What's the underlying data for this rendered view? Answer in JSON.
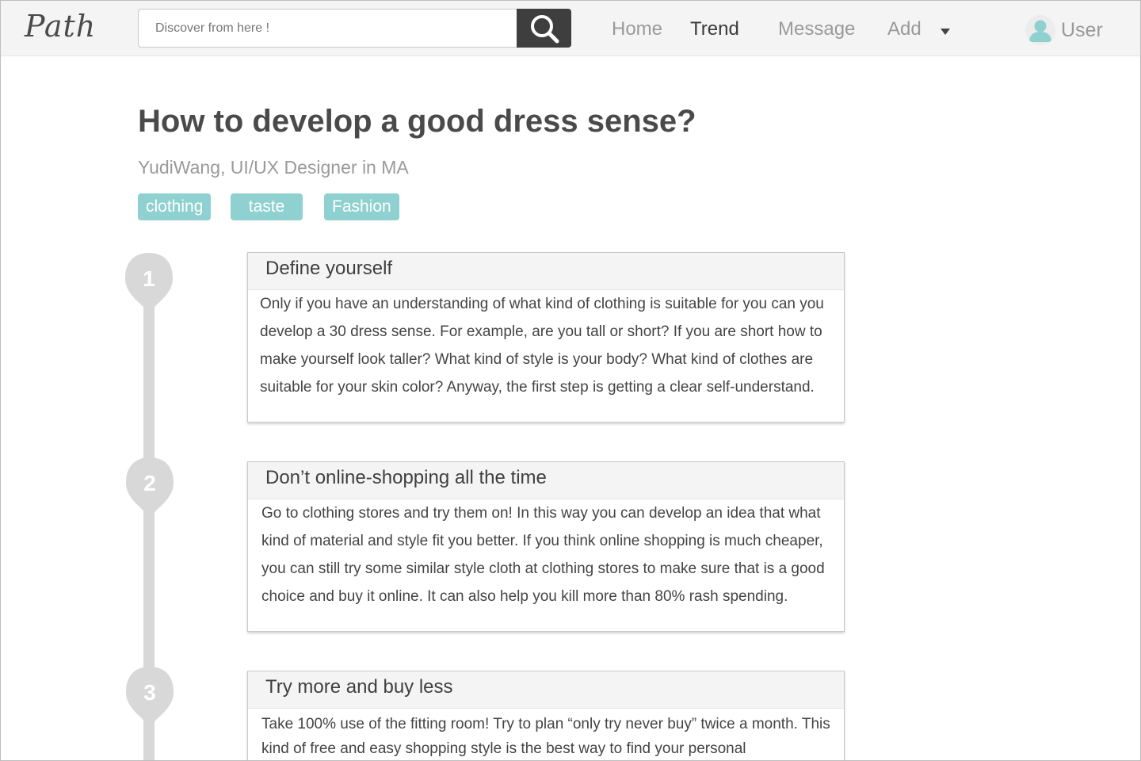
{
  "app": {
    "logo": "Path"
  },
  "search": {
    "placeholder": "Discover from here !"
  },
  "nav": {
    "home": "Home",
    "trend": "Trend",
    "message": "Message",
    "add": "Add",
    "user": "User"
  },
  "article": {
    "title": "How to develop a good dress sense?",
    "author": "YudiWang, UI/UX Designer in MA",
    "tags": [
      "clothing",
      "taste",
      "Fashion"
    ],
    "steps": [
      {
        "number": "1",
        "heading": "Define yourself",
        "body": "Only if you have an understanding of what kind of clothing is suitable for you can you develop a 30 dress sense. For example, are you tall or short? If you are short how to make yourself look taller? What kind of style is your body? What kind of clothes are suitable for your skin color? Anyway, the first step is getting a clear self-understand."
      },
      {
        "number": "2",
        "heading": "Don’t online-shopping all the time",
        "body": "Go to clothing stores and try them on! In this way you can develop an idea that what kind of material and style fit you better. If you think online shopping is much cheaper, you can still try some similar style cloth at clothing stores to make sure that is a good choice and buy it online. It can also help you kill more than 80% rash spending."
      },
      {
        "number": "3",
        "heading": "Try more and buy less",
        "body": "Take 100% use of the fitting room! Try to plan “only try never buy” twice a month. This kind of free and easy shopping style is the best way to find your personal"
      }
    ]
  },
  "colors": {
    "tag_bg": "#8fd0d0",
    "search_button": "#3e3e3e",
    "timeline": "#d8d8d8",
    "user_icon": "#8fd0d0"
  }
}
